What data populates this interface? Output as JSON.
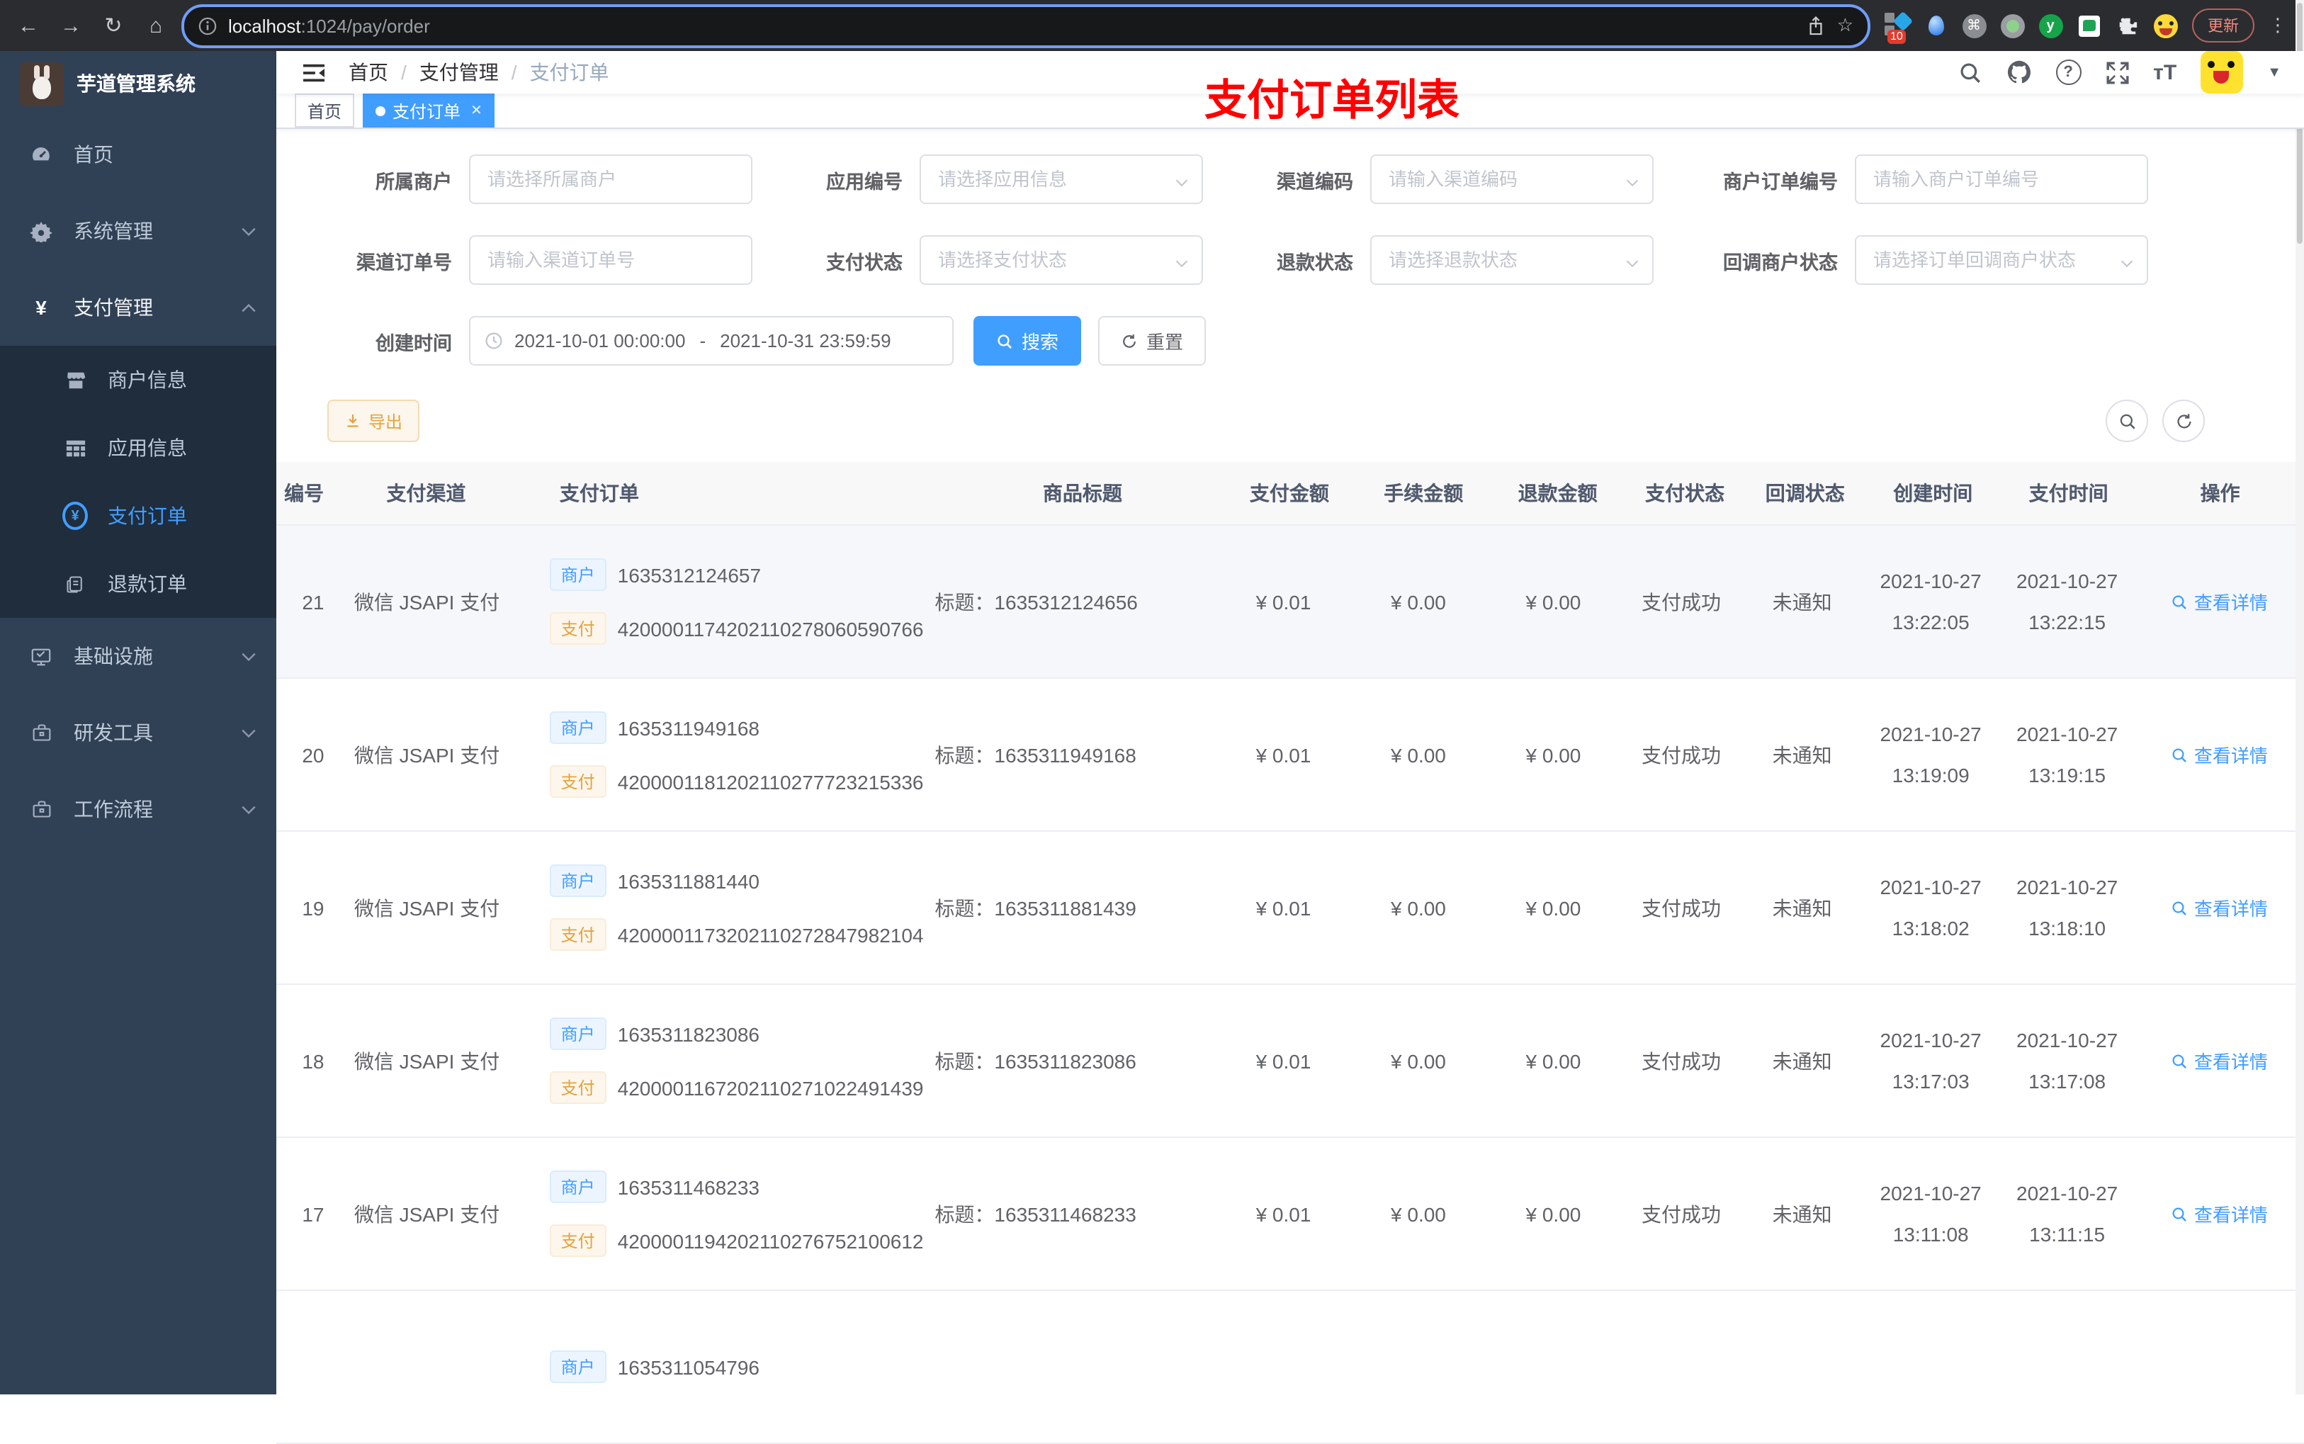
{
  "browser": {
    "url_host": "localhost",
    "url_rest": ":1024/pay/order",
    "extension_badge": "10",
    "update_button": "更新"
  },
  "sidebar": {
    "title": "芋道管理系统",
    "home": "首页",
    "system": "系统管理",
    "payment": "支付管理",
    "merchant_info": "商户信息",
    "app_info": "应用信息",
    "pay_order": "支付订单",
    "refund_order": "退款订单",
    "infra": "基础设施",
    "dev_tools": "研发工具",
    "workflow": "工作流程"
  },
  "header": {
    "breadcrumb": [
      "首页",
      "支付管理",
      "支付订单"
    ],
    "annotation": "支付订单列表"
  },
  "tabs": {
    "home": "首页",
    "current": "支付订单"
  },
  "filters": {
    "merchant": {
      "label": "所属商户",
      "placeholder": "请选择所属商户"
    },
    "app": {
      "label": "应用编号",
      "placeholder": "请选择应用信息"
    },
    "channel_code": {
      "label": "渠道编码",
      "placeholder": "请输入渠道编码"
    },
    "merchant_order_no": {
      "label": "商户订单编号",
      "placeholder": "请输入商户订单编号"
    },
    "channel_order_no": {
      "label": "渠道订单号",
      "placeholder": "请输入渠道订单号"
    },
    "pay_status": {
      "label": "支付状态",
      "placeholder": "请选择支付状态"
    },
    "refund_status": {
      "label": "退款状态",
      "placeholder": "请选择退款状态"
    },
    "notify_status": {
      "label": "回调商户状态",
      "placeholder": "请选择订单回调商户状态"
    },
    "create_time": {
      "label": "创建时间",
      "start": "2021-10-01 00:00:00",
      "end": "2021-10-31 23:59:59"
    },
    "search": "搜索",
    "reset": "重置"
  },
  "toolbar": {
    "export": "导出"
  },
  "table": {
    "merchant_tag": "商户",
    "pay_tag": "支付",
    "view_detail": "查看详情",
    "columns": [
      "编号",
      "支付渠道",
      "支付订单",
      "商品标题",
      "支付金额",
      "手续金额",
      "退款金额",
      "支付状态",
      "回调状态",
      "创建时间",
      "支付时间",
      "操作"
    ],
    "rows": [
      {
        "id": "21",
        "channel": "微信 JSAPI 支付",
        "merchant_no": "1635312124657",
        "pay_no": "4200001174202110278060590766",
        "title": "标题：1635312124656",
        "amount": "¥ 0.01",
        "fee": "¥ 0.00",
        "refund": "¥ 0.00",
        "status": "支付成功",
        "notify": "未通知",
        "created_date": "2021-10-27",
        "created_time": "13:22:05",
        "paid_date": "2021-10-27",
        "paid_time": "13:22:15",
        "hover": true
      },
      {
        "id": "20",
        "channel": "微信 JSAPI 支付",
        "merchant_no": "1635311949168",
        "pay_no": "4200001181202110277723215336",
        "title": "标题：1635311949168",
        "amount": "¥ 0.01",
        "fee": "¥ 0.00",
        "refund": "¥ 0.00",
        "status": "支付成功",
        "notify": "未通知",
        "created_date": "2021-10-27",
        "created_time": "13:19:09",
        "paid_date": "2021-10-27",
        "paid_time": "13:19:15"
      },
      {
        "id": "19",
        "channel": "微信 JSAPI 支付",
        "merchant_no": "1635311881440",
        "pay_no": "4200001173202110272847982104",
        "title": "标题：1635311881439",
        "amount": "¥ 0.01",
        "fee": "¥ 0.00",
        "refund": "¥ 0.00",
        "status": "支付成功",
        "notify": "未通知",
        "created_date": "2021-10-27",
        "created_time": "13:18:02",
        "paid_date": "2021-10-27",
        "paid_time": "13:18:10"
      },
      {
        "id": "18",
        "channel": "微信 JSAPI 支付",
        "merchant_no": "1635311823086",
        "pay_no": "4200001167202110271022491439",
        "title": "标题：1635311823086",
        "amount": "¥ 0.01",
        "fee": "¥ 0.00",
        "refund": "¥ 0.00",
        "status": "支付成功",
        "notify": "未通知",
        "created_date": "2021-10-27",
        "created_time": "13:17:03",
        "paid_date": "2021-10-27",
        "paid_time": "13:17:08"
      },
      {
        "id": "17",
        "channel": "微信 JSAPI 支付",
        "merchant_no": "1635311468233",
        "pay_no": "4200001194202110276752100612",
        "title": "标题：1635311468233",
        "amount": "¥ 0.01",
        "fee": "¥ 0.00",
        "refund": "¥ 0.00",
        "status": "支付成功",
        "notify": "未通知",
        "created_date": "2021-10-27",
        "created_time": "13:11:08",
        "paid_date": "2021-10-27",
        "paid_time": "13:11:15"
      },
      {
        "merchant_no": "1635311054796",
        "partial": true
      }
    ]
  }
}
